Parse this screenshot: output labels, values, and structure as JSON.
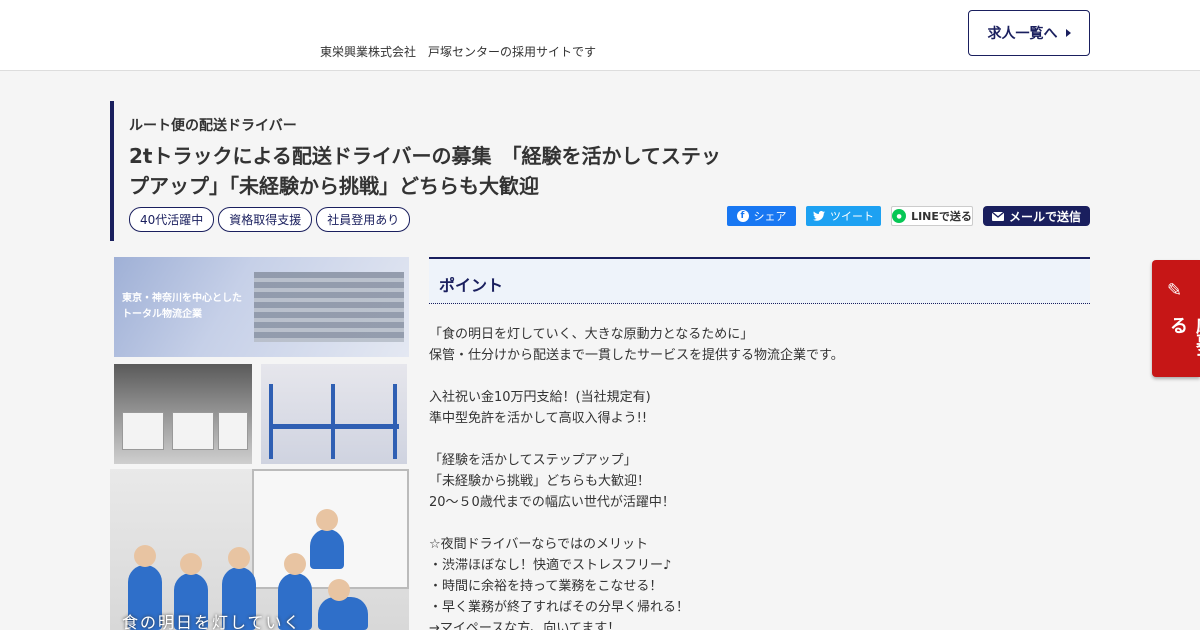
{
  "header": {
    "tagline": "東栄興業株式会社　戸塚センターの採用サイトです",
    "job_list_label": "求人一覧へ"
  },
  "job": {
    "category": "ルート便の配送ドライバー",
    "title": "2tトラックによる配送ドライバーの募集　「経験を活かしてステップアップ」「未経験から挑戦」どちらも大歓迎",
    "tags": [
      "40代活躍中",
      "資格取得支援",
      "社員登用あり"
    ]
  },
  "share": {
    "facebook_label": "シェア",
    "twitter_label": "ツイート",
    "line_label": "LINEで送る",
    "mail_label": "メールで送信"
  },
  "images": {
    "top_text_line1": "東京・神奈川を中心とした",
    "top_text_line2": "トータル物流企業",
    "staff_caption": "食の明日を灯していく"
  },
  "point": {
    "heading": "ポイント",
    "lines": [
      "「食の明日を灯していく、大きな原動力となるために」",
      "保管・仕分けから配送まで一貫したサービスを提供する物流企業です。",
      "",
      "入社祝い金10万円支給！(当社規定有)",
      "準中型免許を活かして高収入得よう!!",
      "",
      "「経験を活かしてステップアップ」",
      "「未経験から挑戦」どちらも大歓迎！",
      "20～５0歳代までの幅広い世代が活躍中！",
      "",
      "☆夜間ドライバーならではのメリット",
      "・渋滞ほぼなし！快適でストレスフリー♪",
      "・時間に余裕を持って業務をこなせる！",
      "・早く業務が終了すればその分早く帰れる！",
      "→マイペースな方、向いてます！"
    ]
  },
  "apply": {
    "label": "応募する"
  },
  "colors": {
    "navy": "#1a1f5e",
    "apply_red": "#c61616",
    "facebook": "#1877f2",
    "twitter": "#1da1f2",
    "line": "#06c755"
  }
}
